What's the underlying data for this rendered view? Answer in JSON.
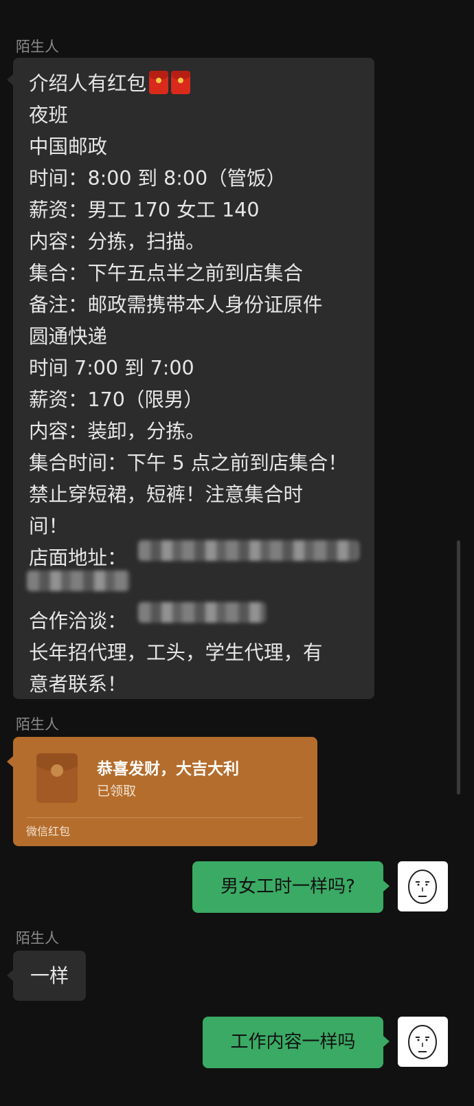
{
  "messages": {
    "sender_1": "陌生人",
    "long_lines": [
      "介绍人有红包",
      "夜班",
      "中国邮政",
      "时间：8:00 到 8:00（管饭）",
      "薪资：男工 170 女工 140",
      "内容：分拣，扫描。",
      "集合：下午五点半之前到店集合",
      "备注：邮政需携带本人身份证原件",
      "圆通快递",
      "时间 7:00 到 7:00",
      "薪资：170（限男）",
      "内容：装卸，分拣。",
      "集合时间：下午 5 点之前到店集合！",
      " 禁止穿短裙，短裤！注意集合时",
      "间！",
      "店面地址：",
      "",
      "合作洽谈：",
      "长年招代理，工头，学生代理，有",
      "意者联系！"
    ],
    "sender_2": "陌生人",
    "red_packet": {
      "title": "恭喜发财，大吉大利",
      "status": "已领取",
      "footer": "微信红包"
    },
    "out_1": "男女工时一样吗?",
    "sender_3": "陌生人",
    "reply_1": "一样",
    "out_2": "工作内容一样吗"
  },
  "icons": {
    "envelope_emoji": "red-envelope-icon",
    "red_packet": "red-packet-icon",
    "avatar": "face-avatar-icon"
  },
  "colors": {
    "background": "#111111",
    "incoming_bubble": "#2c2c2c",
    "outgoing_bubble": "#3aaa64",
    "red_packet": "#b46d2c"
  }
}
